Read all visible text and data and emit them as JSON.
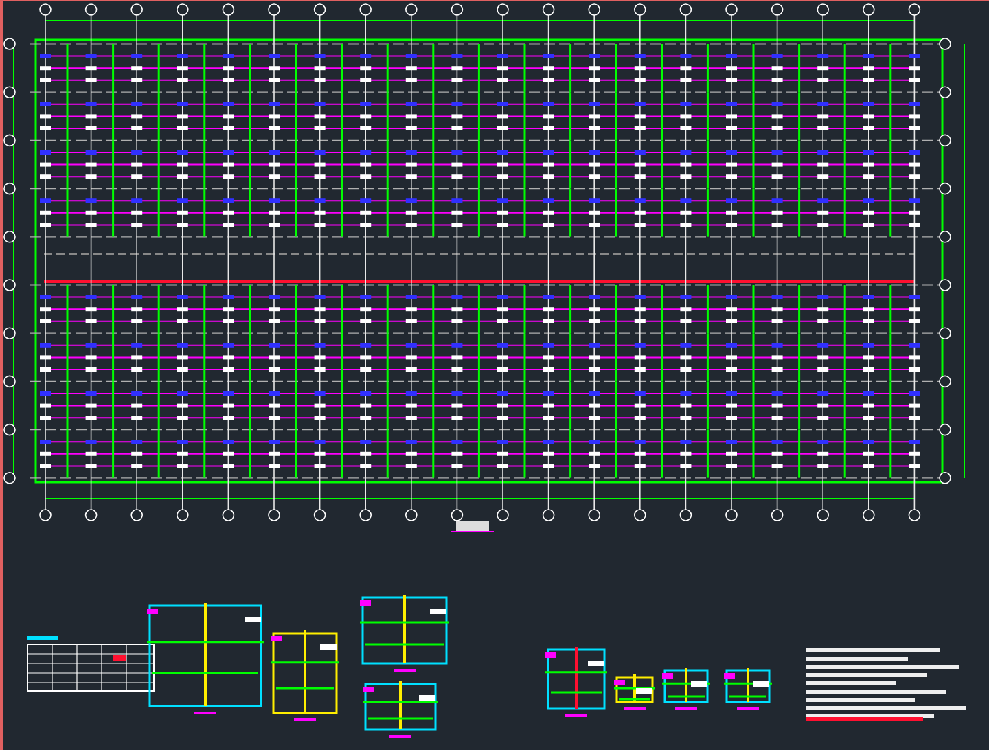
{
  "plan_view": {
    "kind": "roof-framing-plan"
  },
  "detail_views": [
    {
      "kind": "schedule-table"
    },
    {
      "kind": "joint-detail"
    },
    {
      "kind": "bracing-detail"
    },
    {
      "kind": "section-detail"
    },
    {
      "kind": "joint-detail"
    },
    {
      "kind": "base-detail"
    },
    {
      "kind": "bracing-detail"
    },
    {
      "kind": "section-detail"
    },
    {
      "kind": "section-detail"
    },
    {
      "kind": "notes"
    }
  ]
}
